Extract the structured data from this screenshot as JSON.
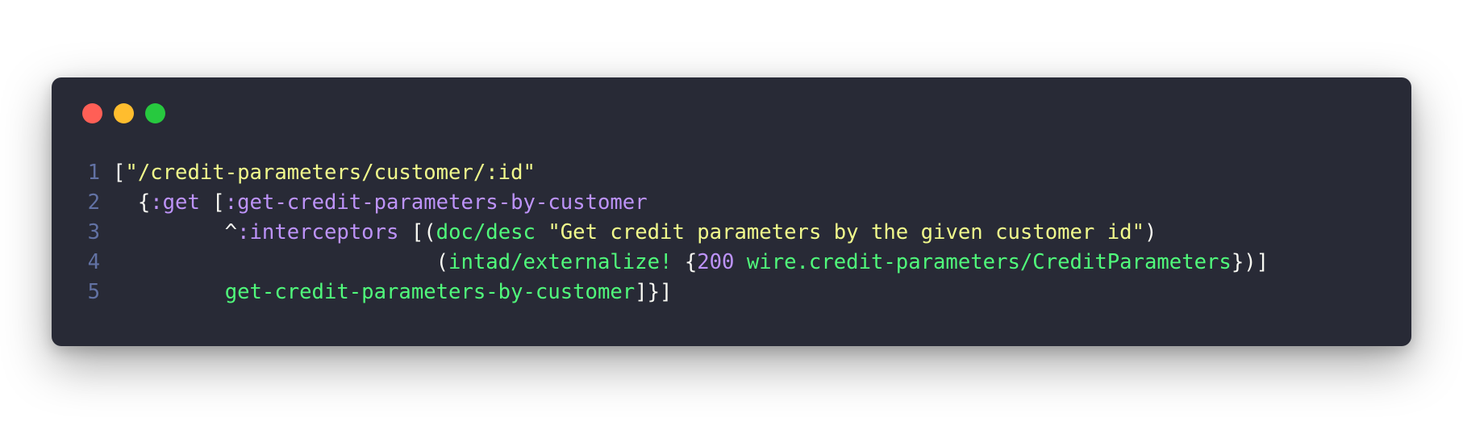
{
  "window": {
    "controls": {
      "close_color": "#ff5f56",
      "minimize_color": "#ffbd2e",
      "maximize_color": "#27c93f"
    }
  },
  "code": {
    "lines": [
      {
        "number": "1",
        "tokens": [
          {
            "type": "plain",
            "text": "["
          },
          {
            "type": "string",
            "text": "\"/credit-parameters/customer/:id\""
          }
        ]
      },
      {
        "number": "2",
        "tokens": [
          {
            "type": "plain",
            "text": "  {"
          },
          {
            "type": "keyword",
            "text": ":get"
          },
          {
            "type": "plain",
            "text": " ["
          },
          {
            "type": "keyword",
            "text": ":get-credit-parameters-by-customer"
          }
        ]
      },
      {
        "number": "3",
        "tokens": [
          {
            "type": "plain",
            "text": "         ^"
          },
          {
            "type": "keyword",
            "text": ":interceptors"
          },
          {
            "type": "plain",
            "text": " [("
          },
          {
            "type": "symbol",
            "text": "doc/desc"
          },
          {
            "type": "plain",
            "text": " "
          },
          {
            "type": "string",
            "text": "\"Get credit parameters by the given customer id\""
          },
          {
            "type": "plain",
            "text": ")"
          }
        ]
      },
      {
        "number": "4",
        "tokens": [
          {
            "type": "plain",
            "text": "                          ("
          },
          {
            "type": "symbol",
            "text": "intad/externalize!"
          },
          {
            "type": "plain",
            "text": " {"
          },
          {
            "type": "number",
            "text": "200"
          },
          {
            "type": "plain",
            "text": " "
          },
          {
            "type": "symbol",
            "text": "wire.credit-parameters/CreditParameters"
          },
          {
            "type": "plain",
            "text": "})]"
          }
        ]
      },
      {
        "number": "5",
        "tokens": [
          {
            "type": "plain",
            "text": "         "
          },
          {
            "type": "symbol",
            "text": "get-credit-parameters-by-customer"
          },
          {
            "type": "plain",
            "text": "]}]"
          }
        ]
      }
    ]
  }
}
